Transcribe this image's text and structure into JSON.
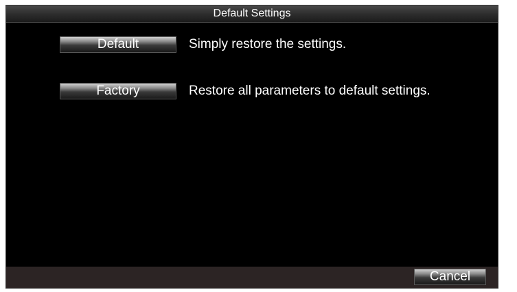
{
  "window": {
    "title": "Default Settings"
  },
  "options": [
    {
      "button_label": "Default",
      "description": "Simply restore the settings."
    },
    {
      "button_label": "Factory",
      "description": "Restore all parameters to default settings."
    }
  ],
  "footer": {
    "cancel_label": "Cancel"
  },
  "colors": {
    "background": "#000000",
    "title_bar": "#2e2e2e",
    "footer_bar": "#2c2424",
    "text": "#ffffff"
  }
}
